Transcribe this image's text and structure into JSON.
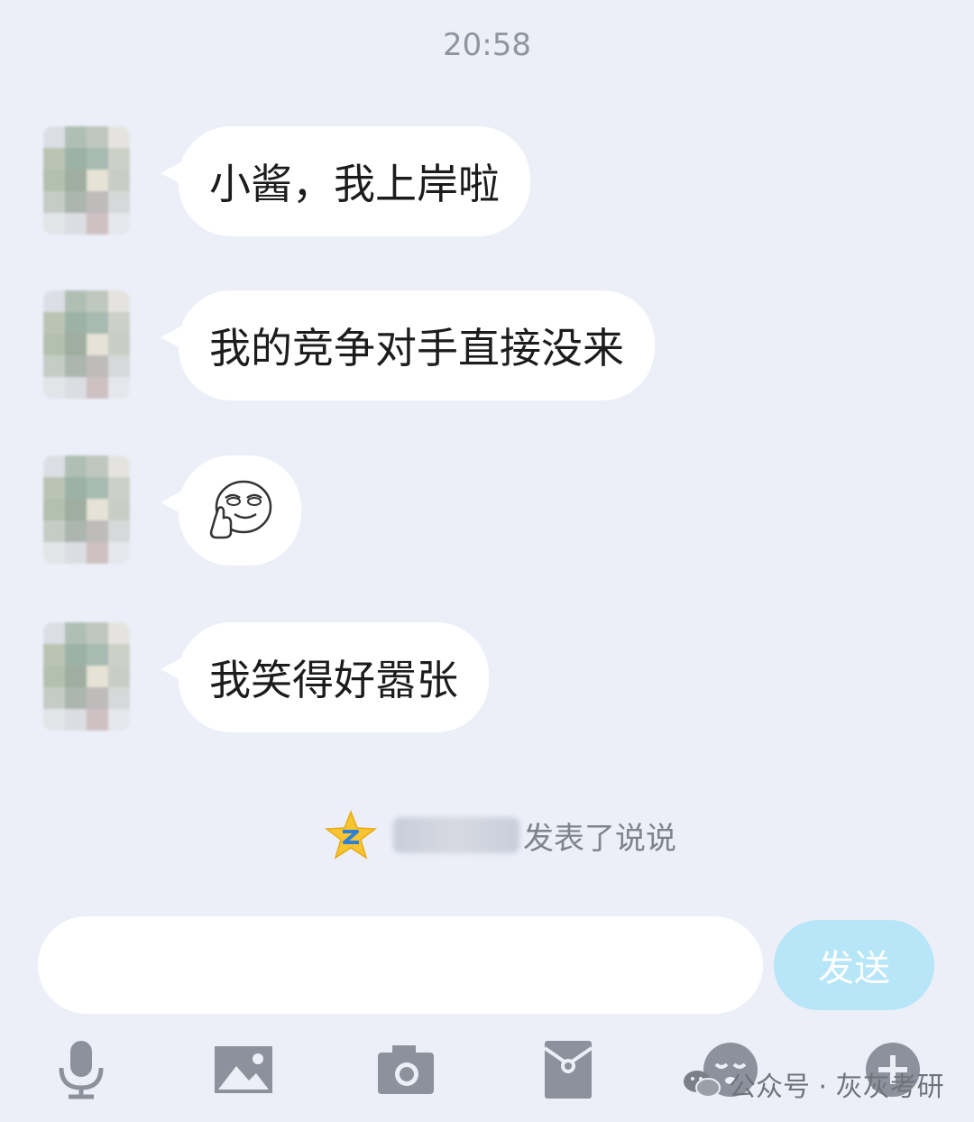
{
  "header": {
    "time": "20:58"
  },
  "messages": [
    {
      "text": "小酱，我上岸啦"
    },
    {
      "text": "我的竞争对手直接没来"
    },
    {
      "sticker": "smirk-thumbs-up-sticker"
    },
    {
      "text": "我笑得好嚣张"
    }
  ],
  "notice": {
    "text": "发表了说说"
  },
  "composer": {
    "input_value": "",
    "send_label": "发送"
  },
  "toolbar": {
    "icons": [
      "microphone-icon",
      "image-icon",
      "camera-icon",
      "red-packet-icon",
      "emoji-icon",
      "plus-icon"
    ]
  },
  "watermark": {
    "text": "公众号 · 灰灰考研"
  },
  "colors": {
    "background": "#ECEFF8",
    "bubble": "#FFFFFF",
    "send_button": "#B6E6F7",
    "icon_gray": "#8C919B"
  }
}
